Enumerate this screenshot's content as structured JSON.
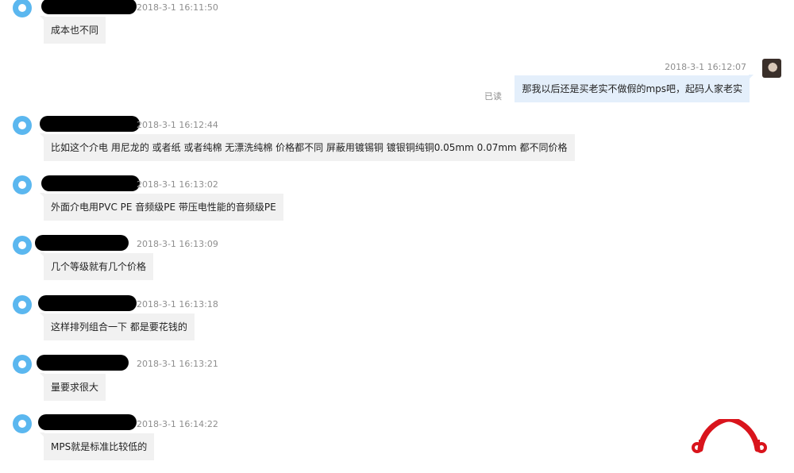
{
  "messages": [
    {
      "timestamp": "2018-3-1 16:11:50",
      "text": "成本也不同",
      "direction": "in"
    },
    {
      "timestamp": "2018-3-1 16:12:07",
      "text": "那我以后还是买老实不做假的mps吧，起码人家老实",
      "direction": "out",
      "read_status": "已读"
    },
    {
      "timestamp": "2018-3-1 16:12:44",
      "text": "比如这个介电 用尼龙的 或者纸 或者纯棉 无漂洗纯棉 价格都不同 屏蔽用镀锡铜 镀银铜纯铜0.05mm 0.07mm 都不同价格",
      "direction": "in"
    },
    {
      "timestamp": "2018-3-1 16:13:02",
      "text": "外面介电用PVC PE 音频级PE 带压电性能的音频级PE",
      "direction": "in"
    },
    {
      "timestamp": "2018-3-1 16:13:09",
      "text": "几个等级就有几个价格",
      "direction": "in"
    },
    {
      "timestamp": "2018-3-1 16:13:18",
      "text": "这样排列组合一下 都是要花钱的",
      "direction": "in"
    },
    {
      "timestamp": "2018-3-1 16:13:21",
      "text": "量要求很大",
      "direction": "in"
    },
    {
      "timestamp": "2018-3-1 16:14:22",
      "text": "MPS就是标准比较低的",
      "direction": "in"
    }
  ],
  "colors": {
    "incoming_bubble": "#f1f1f1",
    "outgoing_bubble": "#e4effb",
    "avatar": "#5bb7ef",
    "logo": "#d9141c"
  }
}
